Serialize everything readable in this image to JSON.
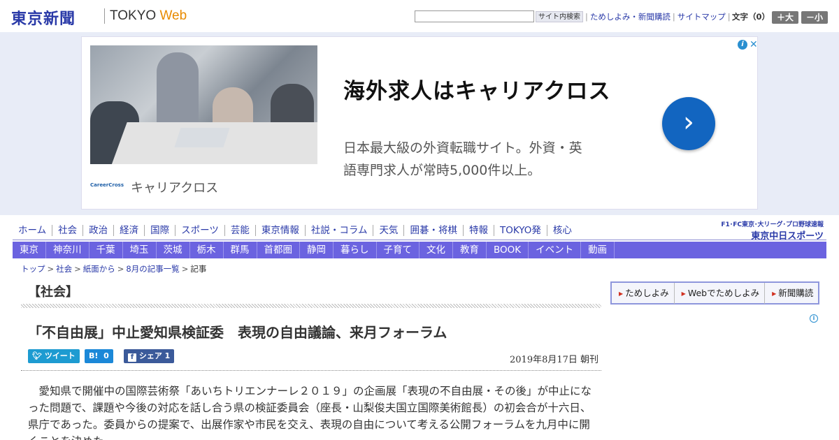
{
  "header": {
    "logo_jp": "東京新聞",
    "logo_en": "TOKYO",
    "logo_web": "Web",
    "search_placeholder": "",
    "search_button": "サイト内検索",
    "links": [
      "ためしよみ・新聞購読",
      "サイトマップ"
    ],
    "font_size_label": "文字（0）",
    "font_larger": "＋大",
    "font_smaller": "－小"
  },
  "ad": {
    "title": "海外求人はキャリアクロス",
    "desc_line1": "日本最大級の外資転職サイト。外資・英",
    "desc_line2": "語専門求人が常時5,000件以上。",
    "brand": "キャリアクロス",
    "logo_small": "CareerCross",
    "cta_glyph": "›",
    "info_glyph": "i",
    "close_glyph": "✕"
  },
  "nav_primary": [
    "ホーム",
    "社会",
    "政治",
    "経済",
    "国際",
    "スポーツ",
    "芸能",
    "東京情報",
    "社説・コラム",
    "天気",
    "囲碁・将棋",
    "特報",
    "TOKYO発",
    "核心"
  ],
  "nav_secondary": [
    "東京",
    "神奈川",
    "千葉",
    "埼玉",
    "茨城",
    "栃木",
    "群馬",
    "首都圏",
    "静岡",
    "暮らし",
    "子育て",
    "文化",
    "教育",
    "BOOK",
    "イベント",
    "動画"
  ],
  "chunichi": {
    "line1": "F1･FC東京･大リーグ･プロ野球速報",
    "line2": "東京中日スポーツ"
  },
  "breadcrumb": [
    "トップ",
    "社会",
    "紙面から",
    "8月の記事一覧",
    "記事"
  ],
  "article": {
    "section": "【社会】",
    "headline": "「不自由展」中止愛知県検証委　表現の自由議論、来月フォーラム",
    "share_tweet": "ツイート",
    "share_hatena_label": "B!",
    "share_hatena_count": "0",
    "share_fb": "シェア 1",
    "date": "2019年8月17日 朝刊",
    "body": "愛知県で開催中の国際芸術祭「あいちトリエンナーレ２０１９」の企画展「表現の不自由展・その後」が中止になった問題で、課題や今後の対応を話し合う県の検証委員会（座長・山梨俊夫国立国際美術館長）の初会合が十六日、県庁であった。委員からの提案で、出展作家や市民を交え、表現の自由について考える公開フォーラムを九月中に開くことを決めた。"
  },
  "sidebar": {
    "items": [
      "ためしよみ",
      "Webでためしよみ",
      "新聞購読"
    ],
    "info_glyph": "i"
  },
  "colors": {
    "brand_blue": "#2a3aa8",
    "nav_bar": "#6b63e0",
    "ad_bg": "#e8ecf7",
    "cta_blue": "#1265c0",
    "accent_orange": "#e88a00"
  }
}
